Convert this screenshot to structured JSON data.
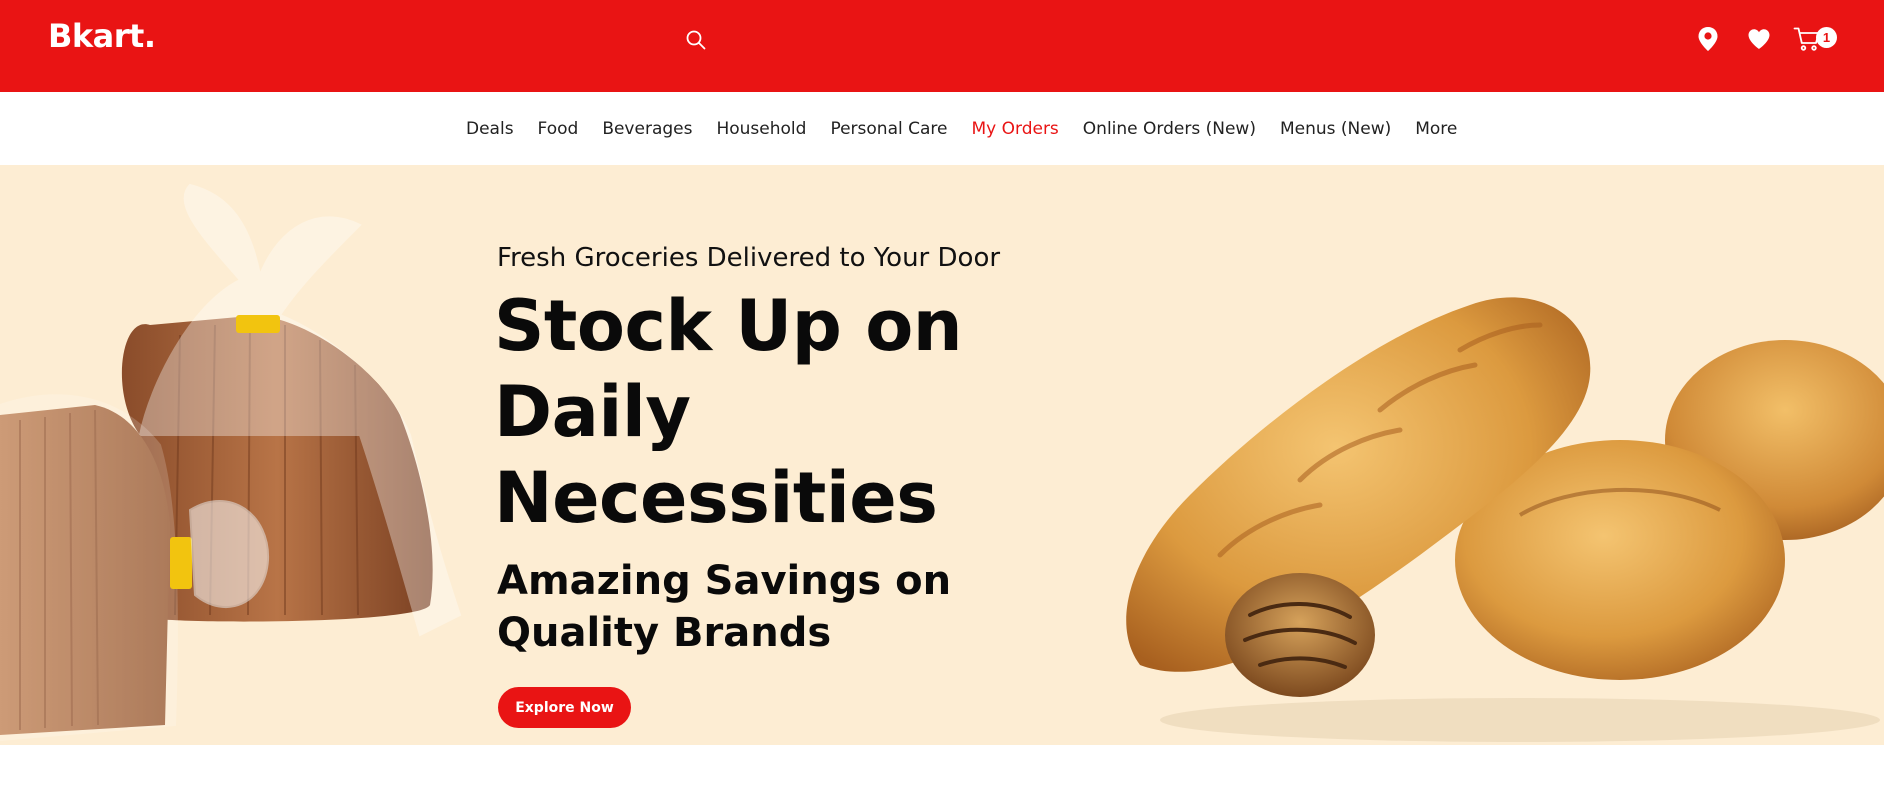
{
  "brand": {
    "logo": "Bkart."
  },
  "header": {
    "search_icon": "search-icon",
    "icons": [
      "location-icon",
      "heart-icon",
      "cart-icon"
    ],
    "cart_count": "1",
    "accent_color": "#e91414"
  },
  "nav": {
    "items": [
      {
        "label": "Deals",
        "active": false
      },
      {
        "label": "Food",
        "active": false
      },
      {
        "label": "Beverages",
        "active": false
      },
      {
        "label": "Household",
        "active": false
      },
      {
        "label": "Personal Care",
        "active": false
      },
      {
        "label": "My Orders",
        "active": true
      },
      {
        "label": "Online Orders (New)",
        "active": false
      },
      {
        "label": "Menus (New)",
        "active": false
      },
      {
        "label": "More",
        "active": false
      }
    ]
  },
  "hero": {
    "eyebrow": "Fresh Groceries Delivered to Your Door",
    "title": "Stock Up on Daily Necessities",
    "subtitle": "Amazing Savings on Quality Brands",
    "cta_label": "Explore Now",
    "background_color": "#fdedd3"
  }
}
